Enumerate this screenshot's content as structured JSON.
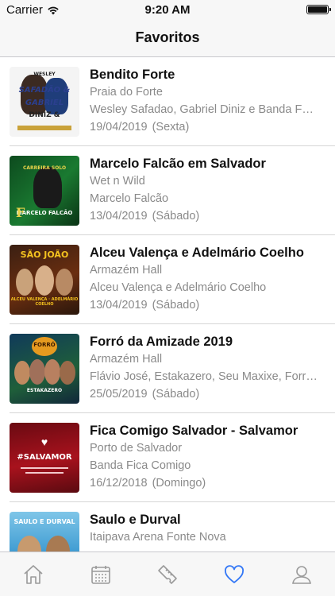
{
  "status_bar": {
    "carrier": "Carrier",
    "time": "9:20 AM"
  },
  "nav": {
    "title": "Favoritos"
  },
  "events": [
    {
      "title": "Bendito Forte",
      "venue": "Praia do Forte",
      "artists": "Wesley Safadao, Gabriel Diniz e Banda Forró",
      "date": "19/04/2019",
      "weekday": "(Sexta)"
    },
    {
      "title": "Marcelo Falcão em Salvador",
      "venue": "Wet n Wild",
      "artists": "Marcelo Falcão",
      "date": "13/04/2019",
      "weekday": "(Sábado)"
    },
    {
      "title": "Alceu Valença e Adelmário Coelho",
      "venue": "Armazém Hall",
      "artists": "Alceu Valença e Adelmário Coelho",
      "date": "13/04/2019",
      "weekday": "(Sábado)"
    },
    {
      "title": "Forró da Amizade 2019",
      "venue": "Armazém Hall",
      "artists": "Flávio José, Estakazero, Seu Maxixe, Forró do Tico",
      "date": "25/05/2019",
      "weekday": "(Sábado)"
    },
    {
      "title": "Fica Comigo Salvador - Salvamor",
      "venue": "Porto de Salvador",
      "artists": "Banda Fica Comigo",
      "date": "16/12/2018",
      "weekday": "(Domingo)"
    },
    {
      "title": "Saulo e Durval",
      "venue": "Itaipava Arena Fonte Nova",
      "artists": "",
      "date": "",
      "weekday": ""
    }
  ],
  "thumbnails": {
    "t1": [
      "WESLEY",
      "SAFADÃO &",
      "GABRIEL",
      "DINIZ &"
    ],
    "t2": [
      "CARREIRA SOLO",
      "MARCELO FALCÃO"
    ],
    "t3": [
      "SÃO JOÃO",
      "ALCEU VALENÇA · ADELMÁRIO COELHO"
    ],
    "t4": [
      "FORRÓ",
      "ESTAKAZERO"
    ],
    "t5": [
      "#SALVAMOR"
    ],
    "t6": [
      "SAULO E DURVAL"
    ]
  },
  "tabs": [
    {
      "name": "home",
      "icon": "home-icon"
    },
    {
      "name": "calendar",
      "icon": "calendar-icon"
    },
    {
      "name": "tickets",
      "icon": "ticket-icon"
    },
    {
      "name": "favorites",
      "icon": "heart-icon",
      "active": true
    },
    {
      "name": "profile",
      "icon": "person-icon"
    }
  ],
  "colors": {
    "accent": "#3478f6",
    "inactive_tab": "#9a9a9a",
    "secondary_text": "#8a8a8a"
  }
}
